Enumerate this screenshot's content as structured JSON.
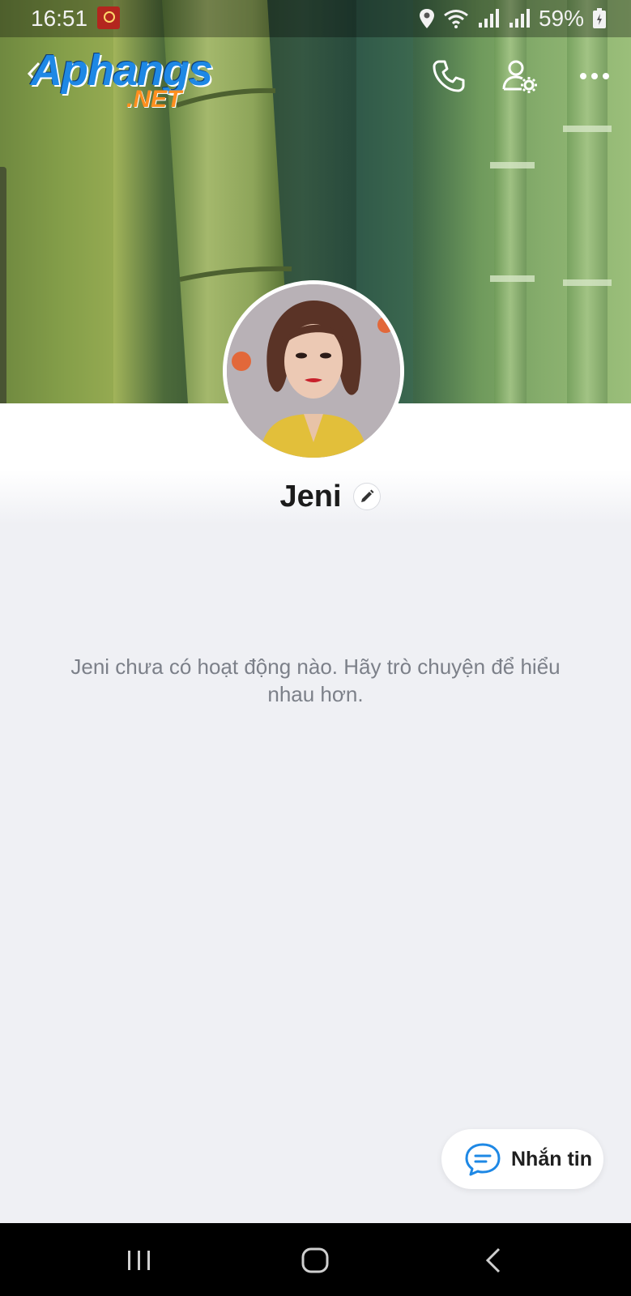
{
  "status_bar": {
    "time": "16:51",
    "battery": "59%"
  },
  "header": {
    "logo_main": "Aphangs",
    "logo_suffix": ".NET",
    "icons": [
      "back-icon",
      "phone-icon",
      "user-settings-icon",
      "more-icon"
    ]
  },
  "profile": {
    "name": "Jeni"
  },
  "feed": {
    "empty_message": "Jeni chưa có hoạt động nào. Hãy trò chuyện để hiểu nhau hơn."
  },
  "actions": {
    "message_label": "Nhắn tin"
  },
  "colors": {
    "accent": "#1e88e5",
    "background": "#eff0f4",
    "nav_bar": "#000000"
  }
}
